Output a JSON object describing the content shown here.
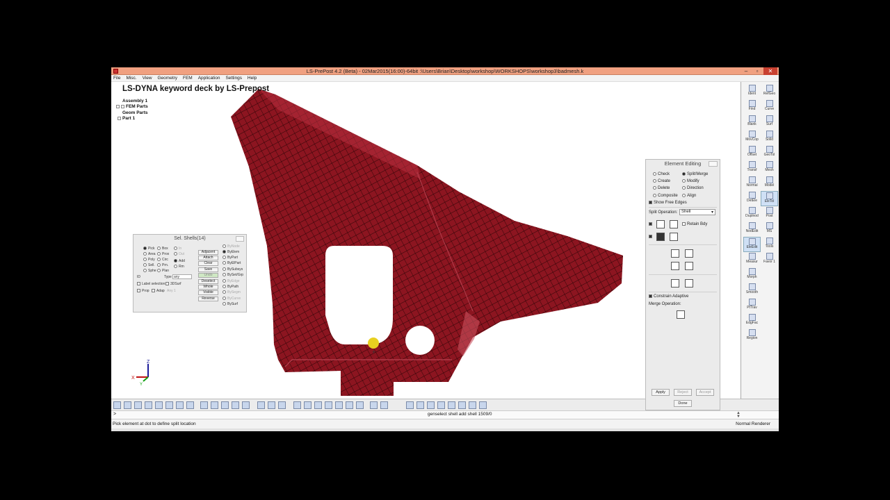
{
  "window": {
    "title": "LS-PrePost 4.2 (Beta) - 02Mar2015(16:00)-64bit :\\Users\\Brian\\Desktop\\workshop\\WORKSHOPS\\workshop3\\badmesh.k",
    "minimize": "–",
    "restore": "▫",
    "close": "✕"
  },
  "menu": [
    "File",
    "Misc.",
    "View",
    "Geometry",
    "FEM",
    "Application",
    "Settings",
    "Help"
  ],
  "viewport": {
    "title": "LS-DYNA keyword deck by LS-Prepost",
    "tree": {
      "assembly": "Assembly 1",
      "fem_parts": "FEM Parts",
      "geom_parts": "Geom Parts",
      "part": "Part 1"
    },
    "triad": {
      "x": "X",
      "y": "Y",
      "z": "Z"
    },
    "part_color": "#8c1520"
  },
  "sel_panel": {
    "title": "Sel. Shells(14)",
    "modes": [
      "Pick",
      "Area",
      "Poly",
      "Sell.",
      "Sphe",
      "Box",
      "Prox",
      "Circ",
      "Prn.",
      "Plan"
    ],
    "in_label": "In",
    "out_label": "Out",
    "add_label": "Add",
    "rm_label": "Rm",
    "actions": [
      "Adjacent",
      "Attach",
      "Clear",
      "Save",
      "Undo",
      "Deselect",
      "Whole",
      "Visible",
      "Reverse"
    ],
    "by": [
      "ByNode",
      "ByElem",
      "ByPart",
      "ByElPart",
      "BySubsys",
      "BySet/Grp",
      "ByEdge",
      "ByPath",
      "BySegm",
      "ByCurve",
      "BySurf"
    ],
    "id_label": "ID",
    "type_label": "Type",
    "type_value": "any",
    "label_sel": "Label selection",
    "surf3d": "3DSurf",
    "prop": "Prop",
    "adap": "Adap",
    "any": "Any",
    "any_value": "1"
  },
  "edit_panel": {
    "title": "Element Editing",
    "ops_left": [
      "Check",
      "Create",
      "Delete",
      "Composite"
    ],
    "ops_right": [
      "Split/Merge",
      "Modify",
      "Direction",
      "Align"
    ],
    "show_free_edges": "Show Free Edges",
    "split_op_label": "Split Operation:",
    "split_op_value": "Shell",
    "retain_bdy": "Retain Bdy",
    "constrain": "Constrain Adaptive",
    "merge_label": "Merge Operation:",
    "apply": "Apply",
    "reject": "Reject",
    "accept": "Accept",
    "done": "Done"
  },
  "right_toolbar": [
    [
      "Ident",
      "RefGeo"
    ],
    [
      "Find",
      "Curve"
    ],
    [
      "Blank",
      "Surf"
    ],
    [
      "MovCop",
      "Solid"
    ],
    [
      "Offset",
      "GeoTol"
    ],
    [
      "Transf",
      "Mesh"
    ],
    [
      "Normal",
      "Model"
    ],
    [
      "DetEle",
      "EleTol"
    ],
    [
      "Duplnod",
      "Post"
    ],
    [
      "NodEdit",
      "MS"
    ],
    [
      "EleEdit",
      "Tools"
    ],
    [
      "Measur",
      "Favor 1"
    ],
    [
      "Morph",
      ""
    ],
    [
      "Smooth",
      ""
    ],
    [
      "PtTrav",
      ""
    ],
    [
      "EdgFac",
      ""
    ],
    [
      "Region",
      ""
    ]
  ],
  "command_line": {
    "prompt": ">",
    "echo": "genselect shell add shell 1509/0"
  },
  "status": {
    "message": "Pick element at dot to define split location",
    "renderer": "Normal Renderer"
  }
}
